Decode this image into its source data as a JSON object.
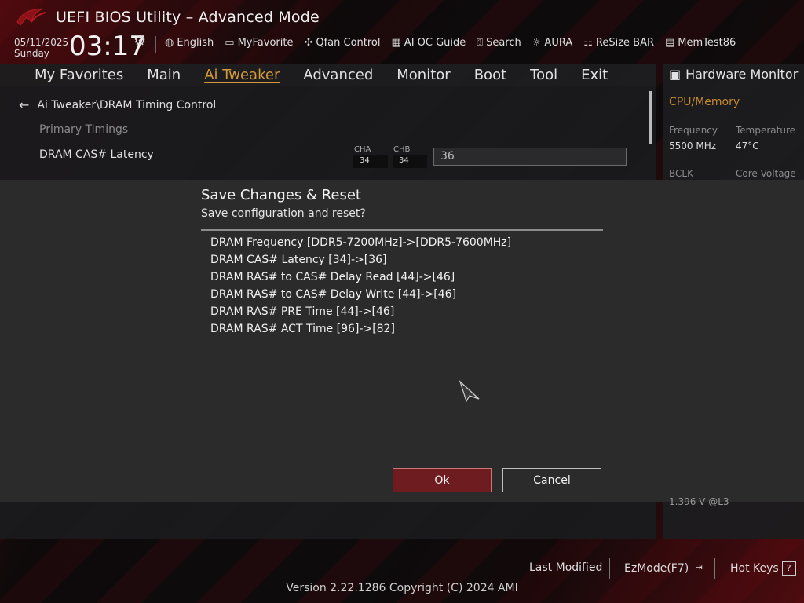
{
  "header": {
    "title": "UEFI BIOS Utility – Advanced Mode",
    "date": "05/11/2025",
    "day": "Sunday",
    "time": "03:17",
    "tools": [
      {
        "label": "English",
        "icon": "globe-icon"
      },
      {
        "label": "MyFavorite",
        "icon": "favorite-icon"
      },
      {
        "label": "Qfan Control",
        "icon": "fan-icon"
      },
      {
        "label": "AI OC Guide",
        "icon": "chip-icon"
      },
      {
        "label": "Search",
        "icon": "search-icon"
      },
      {
        "label": "AURA",
        "icon": "aura-icon"
      },
      {
        "label": "ReSize BAR",
        "icon": "resize-bar-icon"
      },
      {
        "label": "MemTest86",
        "icon": "memory-icon"
      }
    ]
  },
  "tabs": [
    "My Favorites",
    "Main",
    "Ai Tweaker",
    "Advanced",
    "Monitor",
    "Boot",
    "Tool",
    "Exit"
  ],
  "active_tab": "Ai Tweaker",
  "main": {
    "breadcrumb": "Ai Tweaker\\DRAM Timing Control",
    "section": "Primary Timings",
    "row_label": "DRAM CAS# Latency",
    "cha_label": "CHA",
    "chb_label": "CHB",
    "cha_value": "34",
    "chb_value": "34",
    "value": "36"
  },
  "hardware_monitor": {
    "title": "Hardware Monitor",
    "section": "CPU/Memory",
    "frequency_label": "Frequency",
    "frequency_value": "5500 MHz",
    "temperature_label": "Temperature",
    "temperature_value": "47°C",
    "bclk_label": "BCLK",
    "core_voltage_label": "Core Voltage",
    "partial_value": "1.396 V @L3"
  },
  "dialog": {
    "title": "Save Changes & Reset",
    "subtitle": "Save configuration and reset?",
    "changes": [
      "DRAM Frequency [DDR5-7200MHz]->[DDR5-7600MHz]",
      "DRAM CAS# Latency [34]->[36]",
      "DRAM RAS# to CAS# Delay Read [44]->[46]",
      "DRAM RAS# to CAS# Delay Write [44]->[46]",
      "DRAM RAS# PRE Time [44]->[46]",
      "DRAM RAS# ACT Time [96]->[82]"
    ],
    "ok_label": "Ok",
    "cancel_label": "Cancel"
  },
  "footer": {
    "last_modified": "Last Modified",
    "ezmode": "EzMode(F7)",
    "hotkeys": "Hot Keys",
    "hotkeys_icon": "?",
    "version": "Version 2.22.1286 Copyright (C) 2024 AMI"
  },
  "colors": {
    "accent": "#d49a3a",
    "ok_button": "#6e1c1f",
    "brand_red": "#8c1218"
  }
}
